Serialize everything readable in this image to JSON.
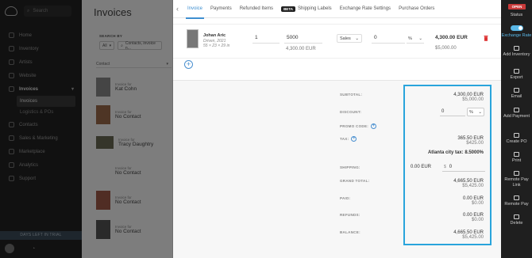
{
  "sidebar": {
    "search_placeholder": "Search",
    "items": [
      {
        "label": "Home",
        "icon": "home-icon"
      },
      {
        "label": "Inventory",
        "icon": "inventory-icon"
      },
      {
        "label": "Artists",
        "icon": "artists-icon"
      },
      {
        "label": "Website",
        "icon": "website-icon"
      },
      {
        "label": "Invoices",
        "icon": "invoices-icon"
      },
      {
        "label": "Contacts",
        "icon": "contacts-icon"
      },
      {
        "label": "Sales & Marketing",
        "icon": "sales-icon"
      },
      {
        "label": "Marketplace",
        "icon": "marketplace-icon"
      },
      {
        "label": "Analytics",
        "icon": "analytics-icon"
      },
      {
        "label": "Support",
        "icon": "support-icon"
      }
    ],
    "sub_items": [
      "Invoices",
      "Logistics & POs"
    ],
    "trial_text": "DAYS LEFT IN TRIAL"
  },
  "list": {
    "title": "Invoices",
    "search_by_label": "SEARCH BY",
    "filter_all": "All",
    "filter_contacts": "Contacts, invoice n...",
    "contact_label": "Contact",
    "rows": [
      {
        "prefix": "Invoice for",
        "name": "Kat Cohn"
      },
      {
        "prefix": "Invoice for",
        "name": "No Contact"
      },
      {
        "prefix": "Invoice for",
        "name": "Tracy Daughtry"
      },
      {
        "prefix": "Invoice for",
        "name": "No Contact"
      },
      {
        "prefix": "Invoice for",
        "name": "No Contact"
      },
      {
        "prefix": "Invoice for",
        "name": "No Contact"
      }
    ]
  },
  "tabs": [
    {
      "label": "Invoice",
      "active": true
    },
    {
      "label": "Payments"
    },
    {
      "label": "Refunded Items"
    },
    {
      "label": "Shipping Labels",
      "badge": "BETA"
    },
    {
      "label": "Exchange Rate Settings"
    },
    {
      "label": "Purchase Orders"
    }
  ],
  "line_item": {
    "artist": "Johan Aric",
    "medium": "Driven, 2021",
    "dimensions": "55 × 23 × 29 in",
    "quantity": "1",
    "price": "5000",
    "price_converted": "4,300.00 EUR",
    "type": "Sales",
    "discount": "0",
    "discount_unit": "%",
    "total": "4,300.00 EUR",
    "total_usd": "$5,000.00"
  },
  "summary": {
    "subtotal_label": "SUBTOTAL:",
    "subtotal": "4,300.00 EUR",
    "subtotal_usd": "$5,000.00",
    "discount_label": "DISCOUNT:",
    "discount_value": "0",
    "discount_unit": "%",
    "promo_label": "PROMO CODE:",
    "tax_label": "TAX:",
    "tax": "365.50 EUR",
    "tax_usd": "$425.00",
    "tax_note": "Atlanta city tax: 8.5000%",
    "shipping_label": "SHIPPING:",
    "shipping_eur": "0.00 EUR",
    "shipping_currency": "$",
    "shipping_value": "0",
    "grand_total_label": "GRAND TOTAL:",
    "grand_total": "4,665.50 EUR",
    "grand_total_usd": "$5,425.00",
    "paid_label": "PAID:",
    "paid": "0.00 EUR",
    "paid_usd": "$0.00",
    "refunds_label": "REFUNDS:",
    "refunds": "0.00 EUR",
    "refunds_usd": "$0.00",
    "balance_label": "BALANCE:",
    "balance": "4,665.50 EUR",
    "balance_usd": "$5,425.00"
  },
  "actions": {
    "status_badge": "OPEN",
    "status": "Status",
    "exchange_rate": "Exchange Rate",
    "add_inventory": "Add Inventory",
    "export": "Export",
    "email": "Email",
    "add_payment": "Add Payment",
    "create_po": "Create PO",
    "print": "Print",
    "remote_pay_link": "Remote Pay Link",
    "remote_pay": "Remote Pay",
    "delete": "Delete"
  },
  "colors": {
    "accent": "#3e8fd0",
    "highlight": "#29a4dc",
    "open_badge": "#c93a3a",
    "sidebar": "#232323"
  }
}
